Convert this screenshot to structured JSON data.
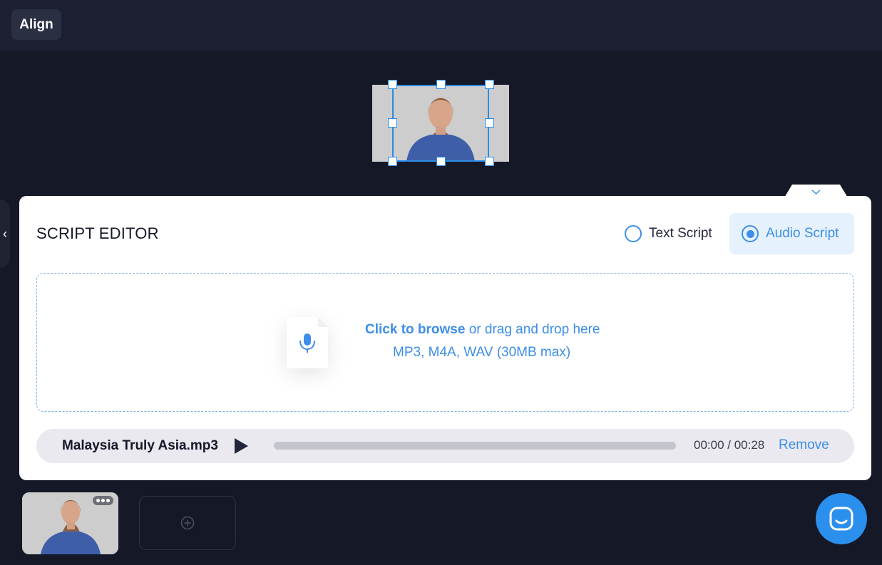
{
  "toolbar": {
    "align_label": "Align"
  },
  "script_editor": {
    "title": "SCRIPT EDITOR",
    "options": [
      {
        "label": "Text Script",
        "selected": false
      },
      {
        "label": "Audio Script",
        "selected": true
      }
    ],
    "dropzone": {
      "browse_link": "Click to browse",
      "rest_text": " or drag and drop here",
      "formats": "MP3, M4A, WAV (30MB max)"
    },
    "player": {
      "filename": "Malaysia Truly Asia.mp3",
      "time": "00:00 / 00:28",
      "progress": 0,
      "remove_label": "Remove"
    }
  },
  "icons": {
    "microphone": "microphone-icon",
    "play": "play-icon",
    "add": "plus-circle-icon",
    "chat": "chat-icon",
    "collapse": "chevron-down-icon",
    "side": "chevron-left-icon"
  },
  "colors": {
    "accent": "#3d8ee8",
    "background": "#141827",
    "panel": "#ffffff"
  }
}
